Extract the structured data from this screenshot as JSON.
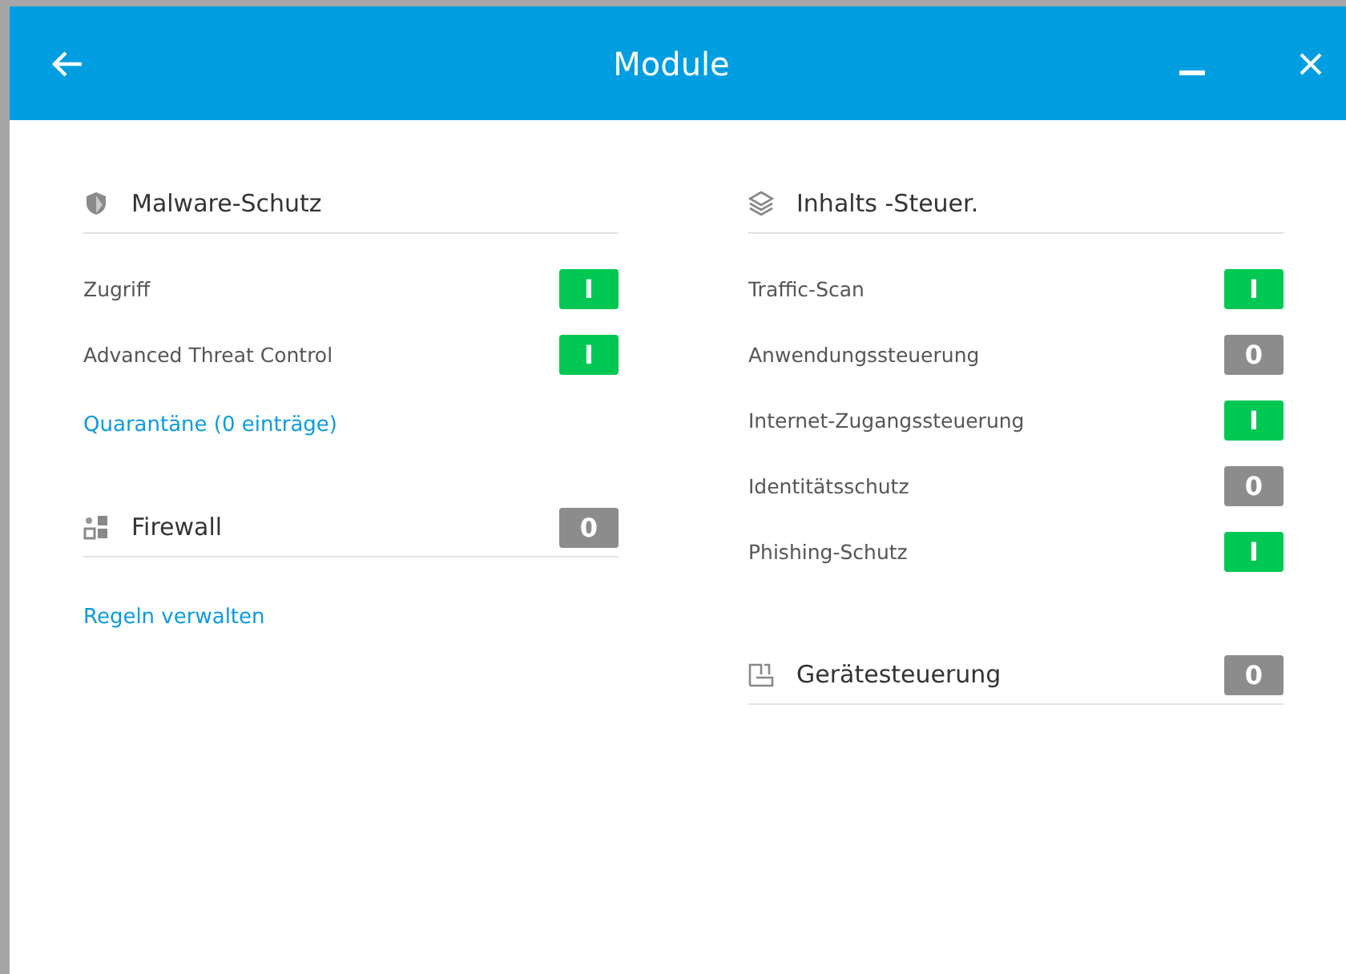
{
  "window": {
    "title": "Module"
  },
  "columns": [
    {
      "sections": [
        {
          "kind": "shield",
          "title": "Malware-Schutz",
          "items": [
            {
              "label": "Zugriff",
              "toggle_text": "I",
              "on": true
            },
            {
              "label": "Advanced Threat Control",
              "toggle_text": "I",
              "on": true
            }
          ],
          "link": "Quarantäne (0 einträge)"
        },
        {
          "kind": "firewall",
          "title": "Firewall",
          "toggle": {
            "toggle_text": "0",
            "on": false
          },
          "link": "Regeln verwalten"
        }
      ]
    },
    {
      "sections": [
        {
          "kind": "layers",
          "title": "Inhalts -Steuer.",
          "items": [
            {
              "label": "Traffic-Scan",
              "toggle_text": "I",
              "on": true
            },
            {
              "label": "Anwendungssteuerung",
              "toggle_text": "0",
              "on": false
            },
            {
              "label": "Internet-Zugangssteuerung",
              "toggle_text": "I",
              "on": true
            },
            {
              "label": "Identitätsschutz",
              "toggle_text": "0",
              "on": false
            },
            {
              "label": "Phishing-Schutz",
              "toggle_text": "I",
              "on": true
            }
          ]
        },
        {
          "kind": "device",
          "title": "Gerätesteuerung",
          "toggle": {
            "toggle_text": "0",
            "on": false
          }
        }
      ]
    }
  ]
}
